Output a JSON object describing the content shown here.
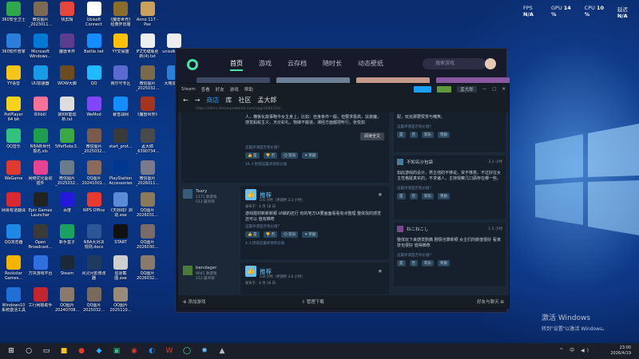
{
  "overlay": {
    "fps_label": "FPS",
    "fps_value": "N/A",
    "gpu_label": "GPU",
    "gpu_value": "14 %",
    "cpu_label": "CPU",
    "cpu_value": "10 %",
    "latency_label": "延迟",
    "latency_value": "N/A"
  },
  "desktop_icons": [
    {
      "label": "360安全卫士",
      "color": "#2ea84a",
      "col": 0,
      "row": 0
    },
    {
      "label": "360软件管家",
      "color": "#2a7fd8",
      "col": 0,
      "row": 1
    },
    {
      "label": "YY语音",
      "color": "#f5c518",
      "col": 0,
      "row": 2
    },
    {
      "label": "PotPlayer 64 bit",
      "color": "#f6d21a",
      "col": 0,
      "row": 3
    },
    {
      "label": "QQ音乐",
      "color": "#31c27c",
      "col": 0,
      "row": 4
    },
    {
      "label": "WeGame",
      "color": "#e03a2f",
      "col": 0,
      "row": 5
    },
    {
      "label": "网易有道翻译",
      "color": "#d9282f",
      "col": 0,
      "row": 6
    },
    {
      "label": "QQ浏览器",
      "color": "#1e88e5",
      "col": 0,
      "row": 7
    },
    {
      "label": "Rockstar Games...",
      "color": "#f4b400",
      "col": 0,
      "row": 8
    },
    {
      "label": "Windows10系统激活工具",
      "color": "#1f6fd6",
      "col": 0,
      "row": 9
    },
    {
      "label": "微信图片_2023011...",
      "color": "#7c6a55",
      "col": 1,
      "row": 0
    },
    {
      "label": "Microsoft Windows...",
      "color": "#0078d4",
      "col": 1,
      "row": 1
    },
    {
      "label": "UU加速器",
      "color": "#1a9be6",
      "col": 1,
      "row": 2
    },
    {
      "label": "Bilibili",
      "color": "#fb7299",
      "col": 1,
      "row": 3
    },
    {
      "label": "NBA新世代报名.xls",
      "color": "#1f9e4f",
      "col": 1,
      "row": 4
    },
    {
      "label": "网络优化驱动插件",
      "color": "#e84393",
      "col": 1,
      "row": 5
    },
    {
      "label": "Epic Games Launcher",
      "color": "#222222",
      "col": 1,
      "row": 6
    },
    {
      "label": "Open Broadcast...",
      "color": "#3a3a3a",
      "col": 1,
      "row": 7
    },
    {
      "label": "方块游戏平台",
      "color": "#2f6fe0",
      "col": 1,
      "row": 8
    },
    {
      "label": "工行网银助手",
      "color": "#c4262e",
      "col": 1,
      "row": 9
    },
    {
      "label": "快剪辑",
      "color": "#e8463b",
      "col": 2,
      "row": 0
    },
    {
      "label": "魔兽世界",
      "color": "#5a3d8c",
      "col": 2,
      "row": 1
    },
    {
      "label": "WOW大脚",
      "color": "#6c4b1f",
      "col": 2,
      "row": 2
    },
    {
      "label": "寂KW能动新.txt",
      "color": "#dddddd",
      "col": 2,
      "row": 3
    },
    {
      "label": "5ffef5ebc3...",
      "color": "#39a845",
      "col": 2,
      "row": 4
    },
    {
      "label": "微信图片_2025032...",
      "color": "#6b7b8a",
      "col": 2,
      "row": 5
    },
    {
      "label": "百度",
      "color": "#2319dc",
      "col": 2,
      "row": 6
    },
    {
      "label": "新手盒子",
      "color": "#1aa260",
      "col": 2,
      "row": 7
    },
    {
      "label": "Steam",
      "color": "#1b2838",
      "col": 2,
      "row": 8
    },
    {
      "label": "QQ图片20240708...",
      "color": "#8a7a6a",
      "col": 2,
      "row": 9
    },
    {
      "label": "Ubisoft Connect",
      "color": "#ffffff",
      "col": 3,
      "row": 0
    },
    {
      "label": "Battle.net",
      "color": "#148eff",
      "col": 3,
      "row": 1
    },
    {
      "label": "QQ",
      "color": "#1ebafc",
      "col": 3,
      "row": 2
    },
    {
      "label": "WeMod",
      "color": "#8046f8",
      "col": 3,
      "row": 3
    },
    {
      "label": "微信图片_2025032...",
      "color": "#7a5a4a",
      "col": 3,
      "row": 4
    },
    {
      "label": "QQ图片20241001...",
      "color": "#8a6a5a",
      "col": 3,
      "row": 5
    },
    {
      "label": "WPS Office",
      "color": "#e8392f",
      "col": 3,
      "row": 6
    },
    {
      "label": "NBA大对决规则.docx",
      "color": "#2b5797",
      "col": 3,
      "row": 7
    },
    {
      "label": "风灵月影修改器",
      "color": "#1e3a5f",
      "col": 3,
      "row": 8
    },
    {
      "label": "QQ图片2025032...",
      "color": "#7a6a5a",
      "col": 3,
      "row": 9
    },
    {
      "label": "《魔兽世界》经典怀旧服",
      "color": "#8b6d2b",
      "col": 4,
      "row": 0
    },
    {
      "label": "YY交易猫",
      "color": "#ffc107",
      "col": 4,
      "row": 1
    },
    {
      "label": "赛尔号专区",
      "color": "#5a6ad0",
      "col": 4,
      "row": 2
    },
    {
      "label": "暴雪战网",
      "color": "#148eff",
      "col": 4,
      "row": 3
    },
    {
      "label": "start_prot...",
      "color": "#3a3a3a",
      "col": 4,
      "row": 4
    },
    {
      "label": "PlayStation Accessories",
      "color": "#003791",
      "col": 4,
      "row": 5
    },
    {
      "label": "《天际线》启动.exe",
      "color": "#5b8ad6",
      "col": 4,
      "row": 6
    },
    {
      "label": "START",
      "color": "#111111",
      "col": 4,
      "row": 7
    },
    {
      "label": "追逐截图.exe",
      "color": "#cfcfcf",
      "col": 4,
      "row": 8
    },
    {
      "label": "QQ图片2025110...",
      "color": "#9a8a7a",
      "col": 4,
      "row": 9
    },
    {
      "label": "Anno 117 - Pax Romana",
      "color": "#c9a15a",
      "col": 5,
      "row": 0
    },
    {
      "label": "IFZ无缝版更新(4).txt",
      "color": "#eeeeee",
      "col": 5,
      "row": 1
    },
    {
      "label": "微信图片_2025032...",
      "color": "#7a6a4a",
      "col": 5,
      "row": 2
    },
    {
      "label": "《魔兽世界》",
      "color": "#a3341f",
      "col": 5,
      "row": 3
    },
    {
      "label": "孟大郎_6390734...",
      "color": "#4a4a4a",
      "col": 5,
      "row": 4
    },
    {
      "label": "微信图片_2026011...",
      "color": "#7a7a8a",
      "col": 5,
      "row": 5
    },
    {
      "label": "QQ图片2026031...",
      "color": "#8a7a5a",
      "col": 5,
      "row": 6
    },
    {
      "label": "QQ图片2026030...",
      "color": "#7a6a6a",
      "col": 5,
      "row": 7
    },
    {
      "label": "QQ图片2026032...",
      "color": "#8a7a6a",
      "col": 5,
      "row": 8
    },
    {
      "label": "unisdkntd...",
      "color": "#eeeeee",
      "col": 6,
      "row": 1
    },
    {
      "label": "大格加速器",
      "color": "#2a7fd8",
      "col": 6,
      "row": 2
    }
  ],
  "watermark": {
    "title": "激活 Windows",
    "subtitle": "转到\"设置\"以激活 Windows。"
  },
  "taskbar": {
    "tray": "^ 中 ◀)",
    "time": "23:00",
    "date": "2026/4/19",
    "apps": [
      {
        "glyph": "⊞",
        "color": "#ffffff"
      },
      {
        "glyph": "○",
        "color": "#ffffff"
      },
      {
        "glyph": "▭",
        "color": "#ffffff"
      },
      {
        "glyph": "■",
        "color": "#f5c518"
      },
      {
        "glyph": "●",
        "color": "#e8392f"
      },
      {
        "glyph": "◆",
        "color": "#1ebafc"
      },
      {
        "glyph": "▣",
        "color": "#31c27c"
      },
      {
        "glyph": "◉",
        "color": "#e03a2f"
      },
      {
        "glyph": "◐",
        "color": "#148eff"
      },
      {
        "glyph": "W",
        "color": "#e8392f"
      },
      {
        "glyph": "◯",
        "color": "#47e3a6"
      },
      {
        "glyph": "✹",
        "color": "#66c0f4"
      },
      {
        "glyph": "▲",
        "color": "#b8bcbf"
      }
    ]
  },
  "launcher": {
    "nav": [
      "首页",
      "游戏",
      "云存档",
      "随时长",
      "动态壁纸"
    ],
    "search_placeholder": "搜索游戏",
    "thumb_colors": [
      "#3e4a63",
      "#6c7f94",
      "#c49b8a",
      "#8a5aa0"
    ]
  },
  "steam": {
    "titlebar": [
      "Steam",
      "查看",
      "好友",
      "游戏",
      "帮助"
    ],
    "user_name": "孟大郎",
    "nav": [
      "商店",
      "库",
      "社区",
      "孟大郎"
    ],
    "url": "https://store.steampowered.com/app/4084320/...",
    "review1": {
      "text": "人，横板化故事略今女主身上，比如：自身条件一般，但要求极高，扶弟魔，感觉蚂蚁主义，天价彩礼，物嫁不搬道，课经方面都把听行。张悦如",
      "button": "阅读全文",
      "helpful": "这篇评测是否有价值？",
      "yes": "是",
      "no": "否",
      "funny": "欢乐",
      "award": "奖励",
      "count": "16 人觉得这篇评测有价值"
    },
    "review2": {
      "user": "Tsary",
      "games": "1171 款游戏",
      "reviews": "513 篇评测",
      "rec": "推荐",
      "hours": "3.6 小时（评测时 3.3 小时）",
      "posted": "发布于：4 月 16 日",
      "text": "游戏题材新新新颖 UI做的还行 有的地方UI要画面看看有点整理 整体找的感觉还可以 值有推荐",
      "helpful": "这篇评测是否有价值？",
      "yes": "是",
      "no": "否",
      "funny": "欢乐",
      "award": "奖励",
      "count": "4 人觉得这篇评测有价值"
    },
    "review3": {
      "user": "bendager",
      "games": "9041 款游戏",
      "reviews": "153 篇评测",
      "rec": "推荐",
      "hours": "3.8 小时（评测时 3.6 小时）",
      "posted": "发布于：4 月 16 日"
    },
    "right1": {
      "text": "配，玩完那要赞赏与嘲笑。",
      "helpful": "这篇评测是否有价值？",
      "yes": "是",
      "no": "否",
      "funny": "欢乐",
      "award": "奖励"
    },
    "right2": {
      "user": "不知名沙包袋",
      "hours": "3.2 小时",
      "text": "如此游戏的设计，男主他的不够说，资不够意。不过好在女主性格挺真实的，不求诸人，主持观察几口顾存在哪一些。",
      "helpful": "这篇评测是否有价值？",
      "yes": "是",
      "no": "否",
      "funny": "欢乐",
      "award": "奖励"
    },
    "right3": {
      "user": "ねこねこし",
      "hours": "1.5 小时",
      "text": "整体玩下来感觉剧痛 剧情也算新颖 女主们的颜值很好 看演技也很好 值得推荐",
      "helpful": "这篇评测是否有价值？",
      "yes": "是",
      "no": "否",
      "funny": "欢乐",
      "award": "奖励"
    },
    "status": {
      "add": "添加游戏",
      "downloads": "管理下载",
      "friends": "好友与聊天"
    }
  }
}
